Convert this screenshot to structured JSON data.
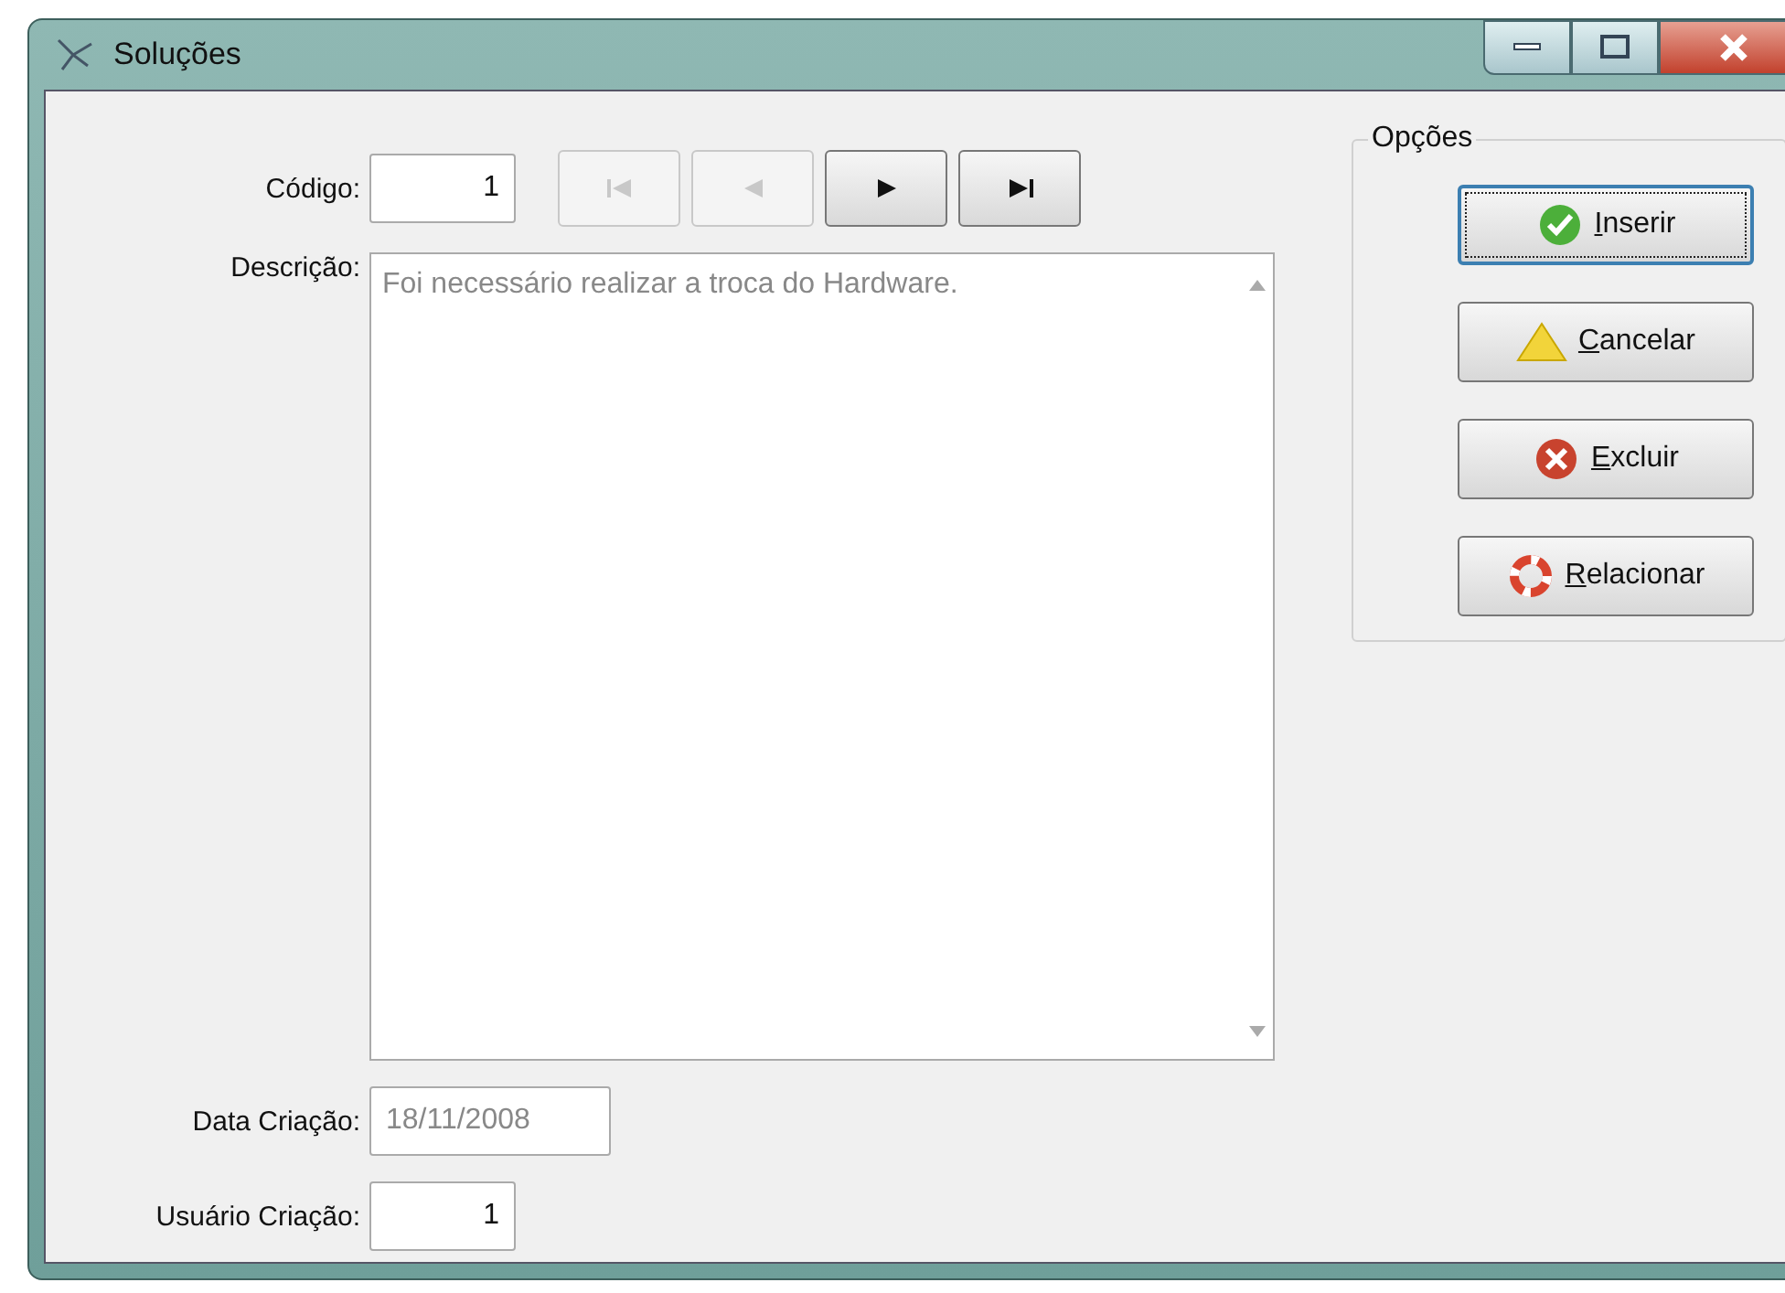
{
  "window": {
    "title": "Soluções"
  },
  "codigo": {
    "label": "Código:",
    "value": "1"
  },
  "nav_buttons": [
    {
      "kind": "first",
      "disabled": true
    },
    {
      "kind": "prev",
      "disabled": true
    },
    {
      "kind": "next",
      "disabled": false
    },
    {
      "kind": "last",
      "disabled": false
    }
  ],
  "descricao": {
    "label": "Descrição:",
    "value": "Foi necessário realizar a troca do Hardware.",
    "read_only": true
  },
  "data_criacao": {
    "label": "Data Criação:",
    "value": "18/11/2008",
    "read_only": true
  },
  "usuario_criacao": {
    "label": "Usuário Criação:",
    "value": "1"
  },
  "opcoes": {
    "title": "Opções",
    "buttons": [
      {
        "kind": "check",
        "key": "I",
        "rest": "nserir",
        "focused": true
      },
      {
        "kind": "warning",
        "key": "C",
        "rest": "ancelar",
        "focused": false
      },
      {
        "kind": "delete",
        "key": "E",
        "rest": "xcluir",
        "focused": false
      },
      {
        "kind": "lifebuoy",
        "key": "R",
        "rest": "elacionar",
        "focused": false
      }
    ]
  }
}
